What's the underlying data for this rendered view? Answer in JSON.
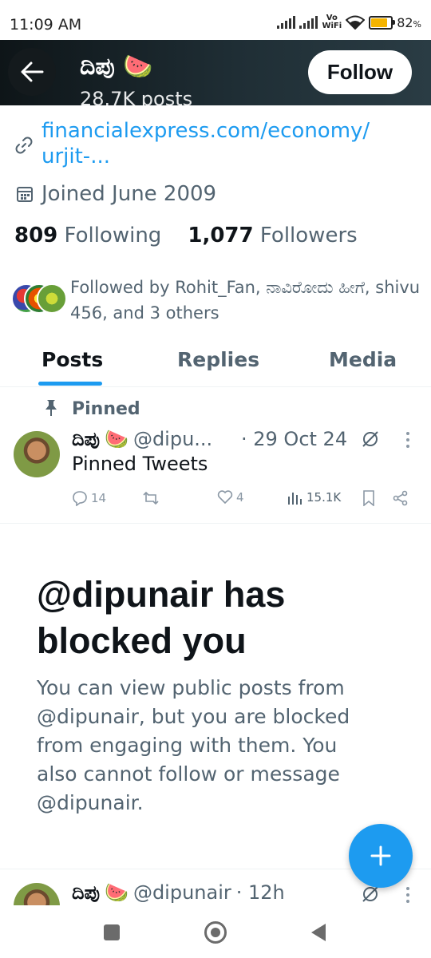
{
  "status_bar": {
    "time": "11:09 AM",
    "network_label_top": "Vo",
    "network_label_bottom": "WiFi",
    "battery_percent": "82",
    "battery_unit": "%",
    "battery_level": 0.82,
    "battery_color": "#f5b400"
  },
  "header": {
    "name": "ದಿಪು",
    "name_emoji": "🍉",
    "posts_count": "28.7K posts",
    "follow_label": "Follow",
    "back_icon": "arrow-left-icon"
  },
  "profile": {
    "link_line1": "financialexpress.com/economy/",
    "link_line2": "urjit-...",
    "joined": "Joined June 2009",
    "following_count": "809",
    "following_label": "Following",
    "followers_count": "1,077",
    "followers_label": "Followers",
    "followed_by": "Followed by Rohit_Fan, ನಾವಿರೋದು ಹೀಗೆ, shivu 456, and 3 others"
  },
  "tabs": [
    {
      "label": "Posts",
      "active": true
    },
    {
      "label": "Replies",
      "active": false
    },
    {
      "label": "Media",
      "active": false
    }
  ],
  "pinned_tweet": {
    "pinned_label": "Pinned",
    "name": "ದಿಪು",
    "emoji": "🍉",
    "handle": "@dipu...",
    "date": "· 29 Oct 24",
    "text": "Pinned Tweets",
    "replies": "14",
    "likes": "4",
    "views": "15.1K"
  },
  "blocked": {
    "title": "@dipunair has blocked you",
    "body": "You can view public posts from @dipunair, but you are blocked from engaging with them. You also cannot follow or message @dipunair."
  },
  "second_tweet": {
    "name": "ದಿಪು",
    "emoji": "🍉",
    "handle": "@dipunair",
    "time": "· 12h"
  },
  "colors": {
    "accent": "#1d9bf0",
    "secondary_text": "#536471",
    "primary_text": "#0f1419"
  }
}
